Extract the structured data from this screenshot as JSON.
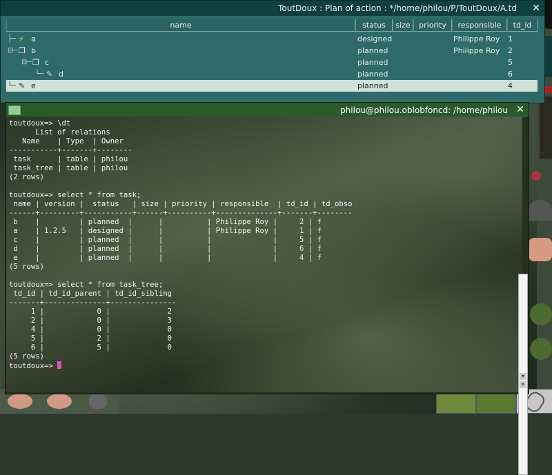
{
  "td_window": {
    "title": "ToutDoux : Plan of action : */home/philou/P/ToutDoux/A.td",
    "close_glyph": "✕",
    "columns": {
      "name": "name",
      "status": "status",
      "size": "size",
      "priority": "priority",
      "responsible": "responsible",
      "td_id": "td_id"
    },
    "rows": [
      {
        "name": "a",
        "status": "designed",
        "responsible": "Philippe Roy",
        "td_id": "1",
        "icon": "lightning-icon",
        "selected": false
      },
      {
        "name": "b",
        "status": "planned",
        "responsible": "Philippe Roy",
        "td_id": "2",
        "icon": "folder-icon",
        "selected": false
      },
      {
        "name": "c",
        "status": "planned",
        "responsible": "",
        "td_id": "5",
        "icon": "folder-icon",
        "selected": false
      },
      {
        "name": "d",
        "status": "planned",
        "responsible": "",
        "td_id": "6",
        "icon": "note-icon",
        "selected": false
      },
      {
        "name": "e",
        "status": "planned",
        "responsible": "",
        "td_id": "4",
        "icon": "note-icon",
        "selected": true
      }
    ]
  },
  "terminal": {
    "title": "philou@philou.oblobfoncd: /home/philou",
    "close_glyph": "✕",
    "output": "toutdoux=> \\dt\n      List of relations\n   Name    | Type  | Owner\n-----------+-------+--------\n task      | table | philou\n task_tree | table | philou\n(2 rows)\n\ntoutdoux=> select * from task;\n name | version |  status   | size | priority | responsible  | td_id | td_obso\n------+---------+-----------+------+----------+--------------+-------+--------\n b    |         | planned  |      |          | Philippe Roy |     2 | f\n a    | 1.2.5   | designed |      |          | Philippe Roy |     1 | f\n c    |         | planned  |      |          |              |     5 | f\n d    |         | planned  |      |          |              |     6 | f\n e    |         | planned  |      |          |              |     4 | f\n(5 rows)\n\ntoutdoux=> select * from task_tree;\n td_id | td_id_parent | td_id_sibling\n-------+--------------+---------------\n     1 |            0 |             2\n     2 |            0 |             3\n     4 |            0 |             0\n     5 |            2 |             0\n     6 |            5 |             0\n(5 rows)\n",
    "prompt": "toutdoux=> "
  },
  "colors": {
    "td_bg": "#2f6a6a",
    "td_selected": "#cfe2d8",
    "terminal_title": "#2a5a2a",
    "cursor": "#e050c0"
  }
}
